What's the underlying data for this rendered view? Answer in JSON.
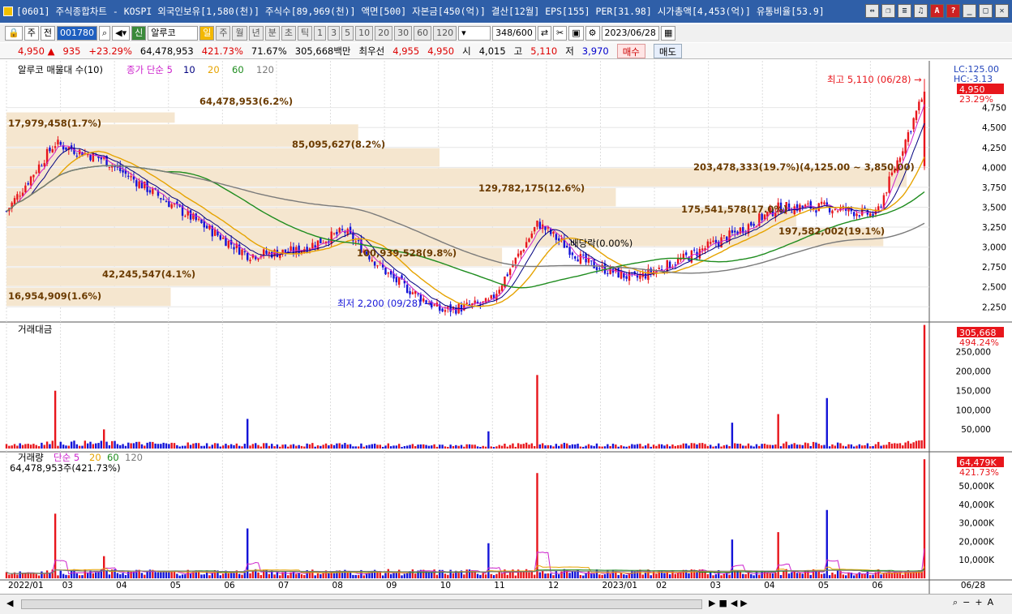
{
  "window": {
    "title": "[0601] 주식종합차트 - KOSPI 외국인보유[1,580(천)] 주식수[89,969(천)] 액면[500] 자본금[450(억)] 결산[12월] EPS[155] PER[31.98] 시가총액[4,453(억)] 유통비율[53.9]",
    "buttons": [
      "⇔",
      "❐",
      "≡",
      "♫",
      "A",
      "?",
      "_",
      "□",
      "✕"
    ]
  },
  "toolbar": {
    "market": "주",
    "prev": "전",
    "code": "001780",
    "credit": "신",
    "name": "알루코",
    "periods": [
      "일",
      "주",
      "월",
      "년",
      "분",
      "초",
      "틱"
    ],
    "intervals": [
      "1",
      "3",
      "5",
      "10",
      "20",
      "30",
      "60",
      "120"
    ],
    "count": "348",
    "count_total": "/600",
    "date": "2023/06/28"
  },
  "quote": {
    "price": "4,950",
    "change": "935",
    "change_pct": "+23.29%",
    "volume": "64,478,953",
    "volume_pct": "421.73%",
    "vol_ratio": "71.67%",
    "amount": "305,668백만",
    "best_label": "최우선",
    "ask": "4,955",
    "bid": "4,950",
    "open_label": "시",
    "open": "4,015",
    "high_label": "고",
    "high": "5,110",
    "low_label": "저",
    "low": "3,970",
    "buy": "매수",
    "sell": "매도"
  },
  "price_panel": {
    "legend": "알루코 매물대 수(10)",
    "ma_legend": [
      "종가 단순 5",
      "10",
      "20",
      "60",
      "120"
    ],
    "lc": "LC:125.00",
    "hc": "HC:-3.13",
    "last": "4,950",
    "last_pct": "23.29%",
    "high_note": "최고 5,110 (06/28) →",
    "low_note": "최저 2,200 (09/28) →",
    "dividend": "배당락(0.00%)",
    "yticks": [
      "4,750",
      "4,500",
      "4,250",
      "4,000",
      "3,750",
      "3,500",
      "3,250",
      "3,000",
      "2,750",
      "2,500",
      "2,250"
    ],
    "vp_labels": [
      "17,979,458(1.7%)",
      "64,478,953(6.2%)",
      "85,095,627(8.2%)",
      "203,478,333(19.7%)(4,125.00 ~ 3,850.00)",
      "129,782,175(12.6%)",
      "175,541,578(17.0%)",
      "197,582,002(19.1%)",
      "100,939,528(9.8%)",
      "42,245,547(4.1%)",
      "16,954,909(1.6%)"
    ],
    "vp_values": [
      17979458,
      64478953,
      85095627,
      203478333,
      129782175,
      175541578,
      197582002,
      100939528,
      42245547,
      16954909
    ]
  },
  "amount_panel": {
    "legend": "거래대금",
    "last": "305,668",
    "last_pct": "494.24%",
    "yticks": [
      "250,000",
      "200,000",
      "150,000",
      "100,000",
      "50,000"
    ]
  },
  "volume_panel": {
    "legend": "거래량",
    "ma_legend": [
      "단순 5",
      "20",
      "60",
      "120"
    ],
    "sub": "64,478,953주(421.73%)",
    "last": "64,479K",
    "last_pct": "421.73%",
    "yticks": [
      "50,000K",
      "40,000K",
      "30,000K",
      "20,000K",
      "10,000K"
    ]
  },
  "xaxis": [
    "2022/01",
    "03",
    "04",
    "05",
    "06",
    "07",
    "08",
    "09",
    "10",
    "11",
    "12",
    "2023/01",
    "02",
    "03",
    "04",
    "05",
    "06"
  ],
  "xaxis_right": "06/28",
  "colors": {
    "up": "#e8161c",
    "down": "#1414d8",
    "ma5": "#cc22cc",
    "ma10": "#000080",
    "ma20": "#e6a300",
    "ma60": "#1e8c1e",
    "ma120": "#7a7a7a",
    "vp": "#f5e6cf"
  },
  "chart_data": {
    "type": "candlestick",
    "period": "daily",
    "date_range": [
      "2022/01",
      "2023/06/28"
    ],
    "price_key": [
      {
        "date": "2022/01",
        "close": 3450
      },
      {
        "date": "2022/02",
        "close": 4300
      },
      {
        "date": "2022/03",
        "close": 4100
      },
      {
        "date": "2022/04",
        "close": 3700
      },
      {
        "date": "2022/05",
        "close": 3300
      },
      {
        "date": "2022/06",
        "close": 2900
      },
      {
        "date": "2022/07",
        "close": 2950
      },
      {
        "date": "2022/08",
        "close": 3200
      },
      {
        "date": "2022/09",
        "close": 2600
      },
      {
        "date": "2022/09/28",
        "close": 2200
      },
      {
        "date": "2022/10",
        "close": 2300
      },
      {
        "date": "2022/11",
        "close": 3300
      },
      {
        "date": "2022/12",
        "close": 2800
      },
      {
        "date": "2023/01",
        "close": 2600
      },
      {
        "date": "2023/02",
        "close": 2850
      },
      {
        "date": "2023/03",
        "close": 3150
      },
      {
        "date": "2023/04",
        "close": 3500
      },
      {
        "date": "2023/05",
        "close": 3500
      },
      {
        "date": "2023/06",
        "close": 3400
      },
      {
        "date": "2023/06/28",
        "close": 4950
      }
    ],
    "volume_spikes_k": [
      {
        "date": "2022/02",
        "value": 35000
      },
      {
        "date": "2022/03",
        "value": 12000
      },
      {
        "date": "2022/06",
        "value": 27000
      },
      {
        "date": "2022/10",
        "value": 19000
      },
      {
        "date": "2022/11",
        "value": 57000
      },
      {
        "date": "2023/03",
        "value": 21000
      },
      {
        "date": "2023/04",
        "value": 25000
      },
      {
        "date": "2023/05",
        "value": 37000
      },
      {
        "date": "2023/06/28",
        "value": 64479
      }
    ]
  }
}
